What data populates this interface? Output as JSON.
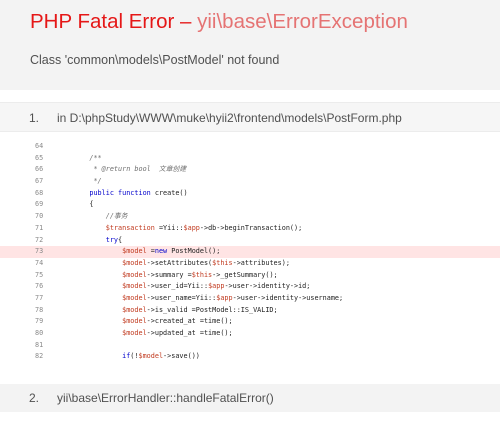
{
  "error": {
    "title": "PHP Fatal Error",
    "separator": " – ",
    "exception_class": "yii\\base\\ErrorException",
    "message": "Class 'common\\models\\PostModel' not found"
  },
  "colors": {
    "title": "#e51717",
    "exception_class": "#e57373",
    "error_line_highlight": "#ffe4e4",
    "variable": "#c13a1f",
    "keyword": "#0000cc"
  },
  "call_stack": [
    {
      "number": "1.",
      "text": "in D:\\phpStudy\\WWW\\muke\\hyii2\\frontend\\models\\PostForm.php"
    },
    {
      "number": "2.",
      "text": "yii\\base\\ErrorHandler::handleFatalError()"
    }
  ],
  "code": {
    "error_line": "73",
    "lines": [
      {
        "n": "64",
        "tokens": []
      },
      {
        "n": "65",
        "tokens": [
          {
            "t": "    /**",
            "k": "c"
          }
        ]
      },
      {
        "n": "66",
        "tokens": [
          {
            "t": "     * @return bool  文章创建",
            "k": "c"
          }
        ]
      },
      {
        "n": "67",
        "tokens": [
          {
            "t": "     */",
            "k": "c"
          }
        ]
      },
      {
        "n": "68",
        "tokens": [
          {
            "t": "    "
          },
          {
            "t": "public function",
            "k": "k"
          },
          {
            "t": " create()"
          }
        ]
      },
      {
        "n": "69",
        "tokens": [
          {
            "t": "    {"
          }
        ]
      },
      {
        "n": "70",
        "tokens": [
          {
            "t": "        //事务",
            "k": "c"
          }
        ]
      },
      {
        "n": "71",
        "tokens": [
          {
            "t": "        "
          },
          {
            "t": "$transaction",
            "k": "v"
          },
          {
            "t": " =Yii::"
          },
          {
            "t": "$app",
            "k": "v"
          },
          {
            "t": "->db->beginTransaction();"
          }
        ]
      },
      {
        "n": "72",
        "tokens": [
          {
            "t": "        "
          },
          {
            "t": "try",
            "k": "k"
          },
          {
            "t": "{"
          }
        ]
      },
      {
        "n": "73",
        "tokens": [
          {
            "t": "            "
          },
          {
            "t": "$model",
            "k": "v"
          },
          {
            "t": " ="
          },
          {
            "t": "new",
            "k": "k"
          },
          {
            "t": " PostModel();"
          }
        ]
      },
      {
        "n": "74",
        "tokens": [
          {
            "t": "            "
          },
          {
            "t": "$model",
            "k": "v"
          },
          {
            "t": "->setAttributes("
          },
          {
            "t": "$this",
            "k": "v"
          },
          {
            "t": "->attributes);"
          }
        ]
      },
      {
        "n": "75",
        "tokens": [
          {
            "t": "            "
          },
          {
            "t": "$model",
            "k": "v"
          },
          {
            "t": "->summary ="
          },
          {
            "t": "$this",
            "k": "v"
          },
          {
            "t": "->_getSummary();"
          }
        ]
      },
      {
        "n": "76",
        "tokens": [
          {
            "t": "            "
          },
          {
            "t": "$model",
            "k": "v"
          },
          {
            "t": "->user_id=Yii::"
          },
          {
            "t": "$app",
            "k": "v"
          },
          {
            "t": "->user->identity->id;"
          }
        ]
      },
      {
        "n": "77",
        "tokens": [
          {
            "t": "            "
          },
          {
            "t": "$model",
            "k": "v"
          },
          {
            "t": "->user_name=Yii::"
          },
          {
            "t": "$app",
            "k": "v"
          },
          {
            "t": "->user->identity->username;"
          }
        ]
      },
      {
        "n": "78",
        "tokens": [
          {
            "t": "            "
          },
          {
            "t": "$model",
            "k": "v"
          },
          {
            "t": "->is_valid =PostModel::IS_VALID;"
          }
        ]
      },
      {
        "n": "79",
        "tokens": [
          {
            "t": "            "
          },
          {
            "t": "$model",
            "k": "v"
          },
          {
            "t": "->created_at =time();"
          }
        ]
      },
      {
        "n": "80",
        "tokens": [
          {
            "t": "            "
          },
          {
            "t": "$model",
            "k": "v"
          },
          {
            "t": "->updated_at =time();"
          }
        ]
      },
      {
        "n": "81",
        "tokens": []
      },
      {
        "n": "82",
        "tokens": [
          {
            "t": "            "
          },
          {
            "t": "if",
            "k": "k"
          },
          {
            "t": "(!"
          },
          {
            "t": "$model",
            "k": "v"
          },
          {
            "t": "->save())"
          }
        ]
      }
    ]
  }
}
